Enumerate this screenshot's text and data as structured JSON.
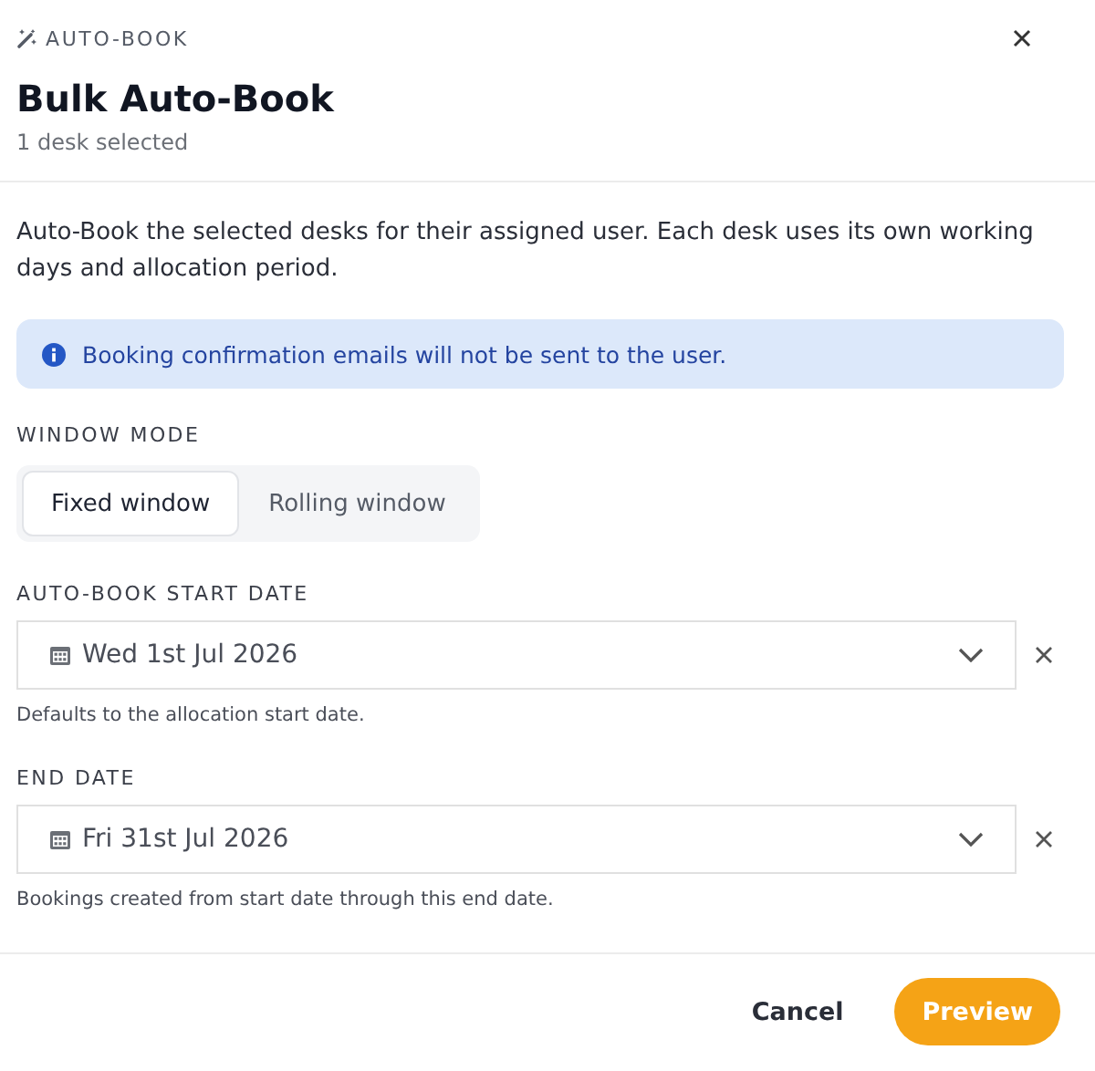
{
  "header": {
    "eyebrow": "AUTO-BOOK",
    "title": "Bulk Auto-Book",
    "subtitle": "1 desk selected"
  },
  "description": "Auto-Book the selected desks for their assigned user. Each desk uses its own working days and allocation period.",
  "notice": "Booking confirmation emails will not be sent to the user.",
  "window_mode": {
    "label": "WINDOW MODE",
    "options": [
      {
        "label": "Fixed window",
        "selected": true
      },
      {
        "label": "Rolling window",
        "selected": false
      }
    ]
  },
  "fields": [
    {
      "label": "AUTO-BOOK START DATE",
      "value": "Wed 1st Jul 2026",
      "hint": "Defaults to the allocation start date."
    },
    {
      "label": "END DATE",
      "value": "Fri 31st Jul 2026",
      "hint": "Bookings created from start date through this end date."
    }
  ],
  "buttons": [
    {
      "label": "Cancel",
      "kind": "secondary"
    },
    {
      "label": "Preview",
      "kind": "primary"
    }
  ]
}
